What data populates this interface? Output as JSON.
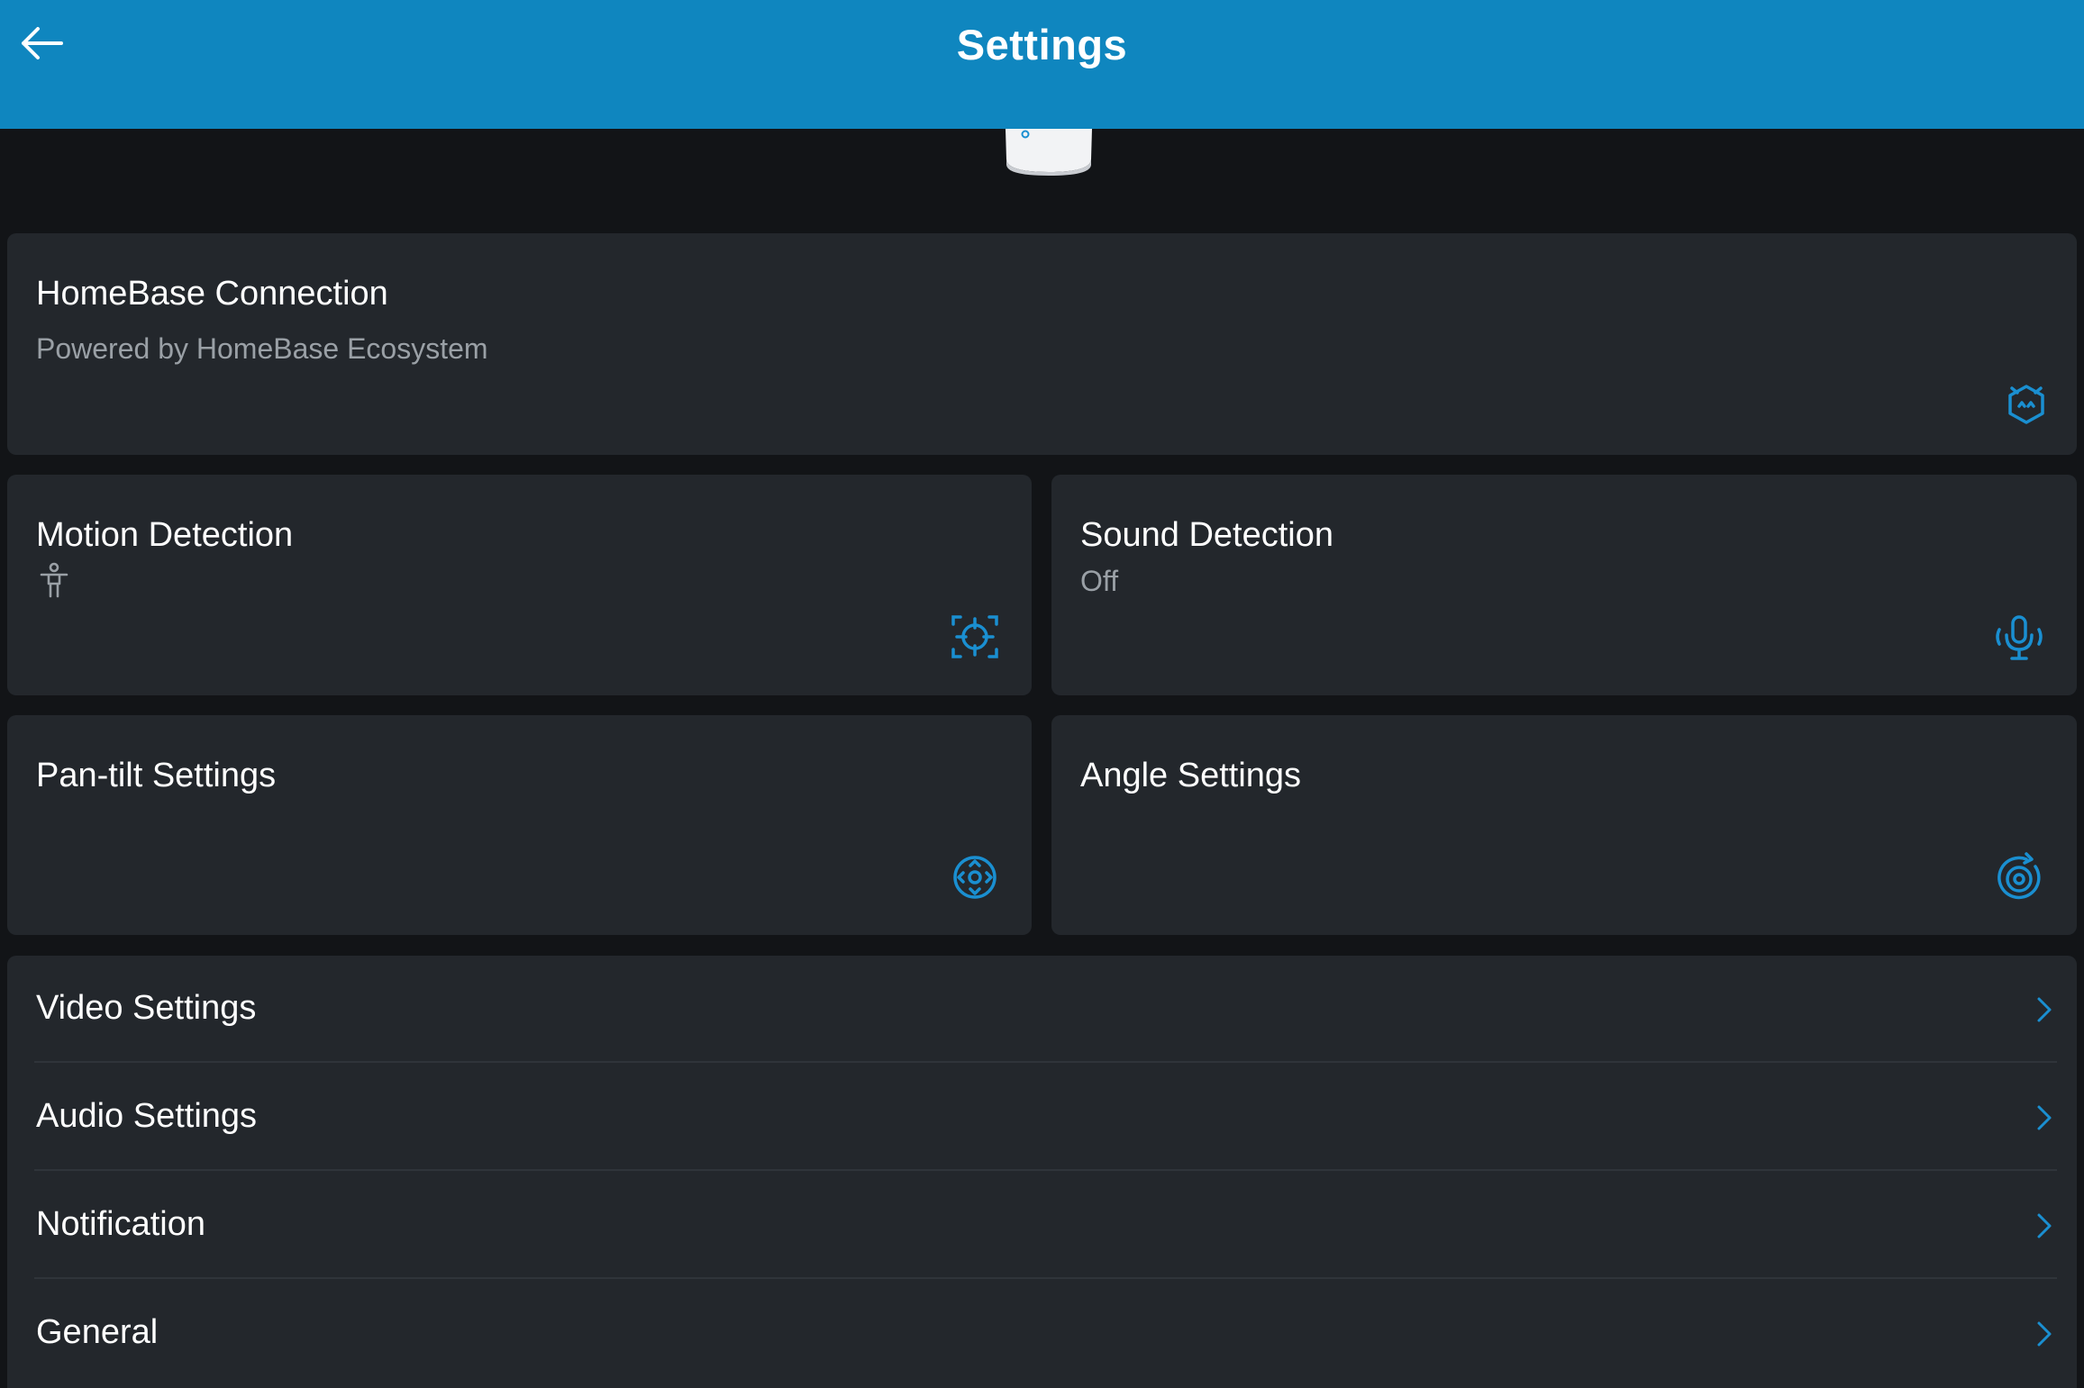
{
  "header": {
    "title": "Settings",
    "back_icon": "arrow-left-icon",
    "background": "#0f86bf"
  },
  "accent_color": "#1a8fd1",
  "cards": {
    "homebase": {
      "title": "HomeBase Connection",
      "subtitle": "Powered by HomeBase Ecosystem",
      "icon": "homebase-robot-icon"
    },
    "motion": {
      "title": "Motion Detection",
      "icon": "motion-target-icon",
      "status_icon": "human-figure-icon"
    },
    "sound": {
      "title": "Sound Detection",
      "subtitle": "Off",
      "icon": "microphone-waves-icon"
    },
    "pantilt": {
      "title": "Pan-tilt Settings",
      "icon": "pan-tilt-dpad-icon"
    },
    "angle": {
      "title": "Angle Settings",
      "icon": "angle-rotate-icon"
    }
  },
  "list": {
    "items": [
      {
        "label": "Video Settings"
      },
      {
        "label": "Audio Settings"
      },
      {
        "label": "Notification"
      },
      {
        "label": "General"
      }
    ]
  }
}
